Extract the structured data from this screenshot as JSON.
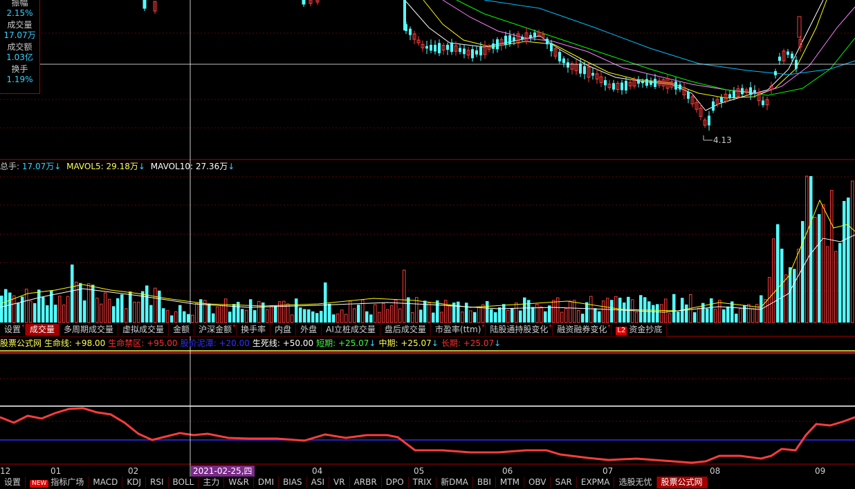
{
  "info_panel": [
    {
      "label": "振幅",
      "value": "2.15%"
    },
    {
      "label": "成交量",
      "value": "17.07万"
    },
    {
      "label": "成交额",
      "value": "1.03亿"
    },
    {
      "label": "换手",
      "value": "1.19%"
    }
  ],
  "price_chart": {
    "low_marker": "4.13"
  },
  "volume_legend": {
    "total": {
      "label": "总手: ",
      "value": "17.07万",
      "arrow": "↓"
    },
    "mavol5": {
      "label": "MAVOL5: ",
      "value": "29.18万",
      "arrow": "↓"
    },
    "mavol10": {
      "label": "MAVOL10: ",
      "value": "27.36万",
      "arrow": "↓"
    }
  },
  "volume_tabs": [
    {
      "label": "设置",
      "dot": true
    },
    {
      "label": "成交量",
      "active": true
    },
    {
      "label": "多周期成交量"
    },
    {
      "label": "虚拟成交量"
    },
    {
      "label": "金额"
    },
    {
      "label": "沪深金额",
      "dot": true
    },
    {
      "label": "换手率"
    },
    {
      "label": "内盘"
    },
    {
      "label": "外盘"
    },
    {
      "label": "AI立桩成交量"
    },
    {
      "label": "盘后成交量"
    },
    {
      "label": "市盈率(ttm)",
      "dot": true
    },
    {
      "label": "陆股通持股变化",
      "dot": true
    },
    {
      "label": "融资融券变化",
      "dot": true
    },
    {
      "label": "资金抄底",
      "badge": "L2"
    }
  ],
  "indicator_legend": {
    "name": "股票公式网",
    "items": [
      {
        "label": "生命线: ",
        "value": "+98.00",
        "color": "#ffff55"
      },
      {
        "label": "生命禁区: ",
        "value": "+95.00",
        "color": "#ff3030"
      },
      {
        "label": "股价泥潭: ",
        "value": "+20.00",
        "color": "#3030ff"
      },
      {
        "label": "生死线: ",
        "value": "+50.00",
        "color": "#ffffff"
      },
      {
        "label": "短期: ",
        "value": "+25.07",
        "color": "#40ff40",
        "arrow": "↓"
      },
      {
        "label": "中期: ",
        "value": "+25.07",
        "color": "#ffff55",
        "arrow": "↓"
      },
      {
        "label": "长期: ",
        "value": "+25.07",
        "color": "#ff3030",
        "arrow": "↓"
      }
    ]
  },
  "x_axis": {
    "labels": [
      "12",
      "01",
      "02",
      "04",
      "05",
      "06",
      "07",
      "08",
      "09"
    ],
    "cursor_date": "2021-02-25,四"
  },
  "bottom_tabs": [
    {
      "label": "设置"
    },
    {
      "label": "指标广场",
      "badge": "NEW"
    },
    {
      "label": "MACD"
    },
    {
      "label": "KDJ"
    },
    {
      "label": "RSI"
    },
    {
      "label": "BOLL"
    },
    {
      "label": "主力"
    },
    {
      "label": "W&R"
    },
    {
      "label": "DMI"
    },
    {
      "label": "BIAS"
    },
    {
      "label": "ASI"
    },
    {
      "label": "VR"
    },
    {
      "label": "ARBR"
    },
    {
      "label": "DPO"
    },
    {
      "label": "TRIX"
    },
    {
      "label": "新DMA"
    },
    {
      "label": "BBI"
    },
    {
      "label": "MTM"
    },
    {
      "label": "OBV"
    },
    {
      "label": "SAR"
    },
    {
      "label": "EXPMA"
    },
    {
      "label": "选股无忧"
    },
    {
      "label": "股票公式网",
      "active": true
    }
  ],
  "colors": {
    "up": "#ff3c3c",
    "down": "#54ffff",
    "ma5": "#ffffff",
    "ma10": "#ffff00",
    "ma20": "#ff80ff",
    "ma30": "#00ff00",
    "ma60": "#00c0ff",
    "grid": "#6a0000"
  }
}
